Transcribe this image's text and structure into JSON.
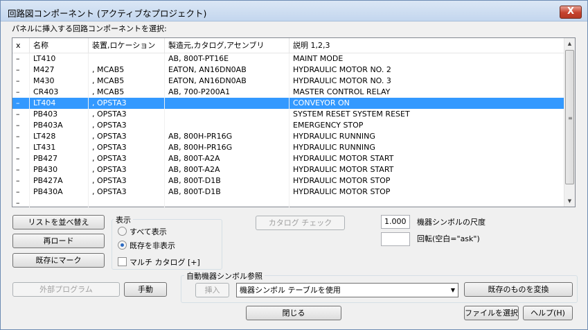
{
  "window": {
    "title": "回路図コンポーネント (アクティブなプロジェクト)",
    "close_label": "X"
  },
  "instruction": "パネルに挿入する回路コンポーネントを選択:",
  "list": {
    "columns": [
      "x",
      "名称",
      "装置,ロケーション",
      "製造元,カタログ,アセンブリ",
      "説明 1,2,3"
    ],
    "selected_index": 4,
    "rows": [
      {
        "x": "–",
        "name": "LT410",
        "loc": "",
        "mfr": "AB, 800T-PT16E",
        "desc": "MAINT MODE"
      },
      {
        "x": "–",
        "name": "M427",
        "loc": ", MCAB5",
        "mfr": "EATON, AN16DN0AB",
        "desc": "HYDRAULIC MOTOR NO. 2"
      },
      {
        "x": "–",
        "name": "M430",
        "loc": ", MCAB5",
        "mfr": "EATON, AN16DN0AB",
        "desc": "HYDRAULIC MOTOR NO. 3"
      },
      {
        "x": "–",
        "name": "CR403",
        "loc": ", MCAB5",
        "mfr": "AB, 700-P200A1",
        "desc": "MASTER CONTROL RELAY"
      },
      {
        "x": "–",
        "name": "LT404",
        "loc": ", OPSTA3",
        "mfr": "",
        "desc": "CONVEYOR ON"
      },
      {
        "x": "–",
        "name": "PB403",
        "loc": ", OPSTA3",
        "mfr": "",
        "desc": "SYSTEM RESET SYSTEM RESET"
      },
      {
        "x": "–",
        "name": "PB403A",
        "loc": ", OPSTA3",
        "mfr": "",
        "desc": "EMERGENCY STOP"
      },
      {
        "x": "–",
        "name": "LT428",
        "loc": ", OPSTA3",
        "mfr": "AB, 800H-PR16G",
        "desc": "HYDRAULIC RUNNING"
      },
      {
        "x": "–",
        "name": "LT431",
        "loc": ", OPSTA3",
        "mfr": "AB, 800H-PR16G",
        "desc": "HYDRAULIC RUNNING"
      },
      {
        "x": "–",
        "name": "PB427",
        "loc": ", OPSTA3",
        "mfr": "AB, 800T-A2A",
        "desc": "HYDRAULIC MOTOR START"
      },
      {
        "x": "–",
        "name": "PB430",
        "loc": ", OPSTA3",
        "mfr": "AB, 800T-A2A",
        "desc": "HYDRAULIC MOTOR START"
      },
      {
        "x": "–",
        "name": "PB427A",
        "loc": ", OPSTA3",
        "mfr": "AB, 800T-D1B",
        "desc": "HYDRAULIC MOTOR STOP"
      },
      {
        "x": "–",
        "name": "PB430A",
        "loc": ", OPSTA3",
        "mfr": "AB, 800T-D1B",
        "desc": "HYDRAULIC MOTOR STOP"
      },
      {
        "x": "–",
        "name": "",
        "loc": "",
        "mfr": "",
        "desc": ""
      }
    ]
  },
  "buttons": {
    "sort_list": "リストを並べ替え",
    "reload": "再ロード",
    "mark_existing": "既存にマーク",
    "catalog_check": "カタログ チェック",
    "external_program": "外部プログラム",
    "manual": "手動",
    "insert": "挿入",
    "convert_existing": "既存のものを変換",
    "close": "閉じる",
    "select_file": "ファイルを選択",
    "help": "ヘルプ(H)"
  },
  "display_group": {
    "label": "表示",
    "show_all": "すべて表示",
    "hide_existing": "既存を非表示",
    "selected": "hide_existing",
    "multi_catalog": "マルチ カタログ [+]",
    "multi_catalog_checked": false
  },
  "scale": {
    "value": "1.000",
    "label": "機器シンボルの尺度"
  },
  "rotation": {
    "value": "",
    "label": "回転(空白=\"ask\")"
  },
  "auto_symbol": {
    "label": "自動機器シンボル参照",
    "dropdown_value": "機器シンボル テーブルを使用"
  },
  "colors": {
    "selection": "#3399ff",
    "close_button": "#c5412c"
  }
}
